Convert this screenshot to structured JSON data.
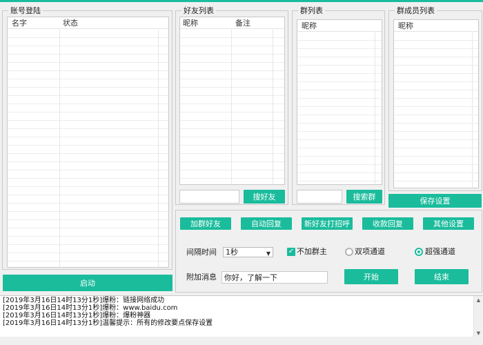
{
  "account_group": {
    "title": "账号登陆",
    "columns": [
      "名字",
      "状态"
    ],
    "start_button": "启动"
  },
  "friends_group": {
    "title": "好友列表",
    "columns": [
      "昵称",
      "备注"
    ],
    "search_input": "",
    "search_button": "搜好友"
  },
  "groups_group": {
    "title": "群列表",
    "columns": [
      "昵称"
    ],
    "search_input": "",
    "search_button": "搜索群"
  },
  "members_group": {
    "title": "群成员列表",
    "columns": [
      "昵称"
    ],
    "save_button": "保存设置"
  },
  "actions": {
    "add_friend": "加群好友",
    "auto_reply": "自动回复",
    "greet_new_friend": "新好友打招呼",
    "receipt_reply": "收款回复",
    "other_settings": "其他设置"
  },
  "settings": {
    "interval_label": "间隔时间",
    "interval_value": "1秒",
    "no_group_owner_label": "不加群主",
    "no_group_owner_checked": true,
    "two_way_label": "双项通道",
    "two_way_selected": false,
    "super_strong_label": "超强通道",
    "super_strong_selected": true,
    "message_label": "附加消息",
    "message_value": "你好，了解一下",
    "start_button": "开始",
    "end_button": "结束"
  },
  "log": [
    "[2019年3月16日14时13分1秒]爆粉：链接网络成功",
    "[2019年3月16日14时13分1秒]爆粉：www.baidu.com",
    "[2019年3月16日14时13分1秒]爆粉：爆粉神器",
    "[2019年3月16日14时13分1秒]温馨提示：所有的修改要点保存设置"
  ],
  "colors": {
    "accent": "#1abc9c"
  }
}
